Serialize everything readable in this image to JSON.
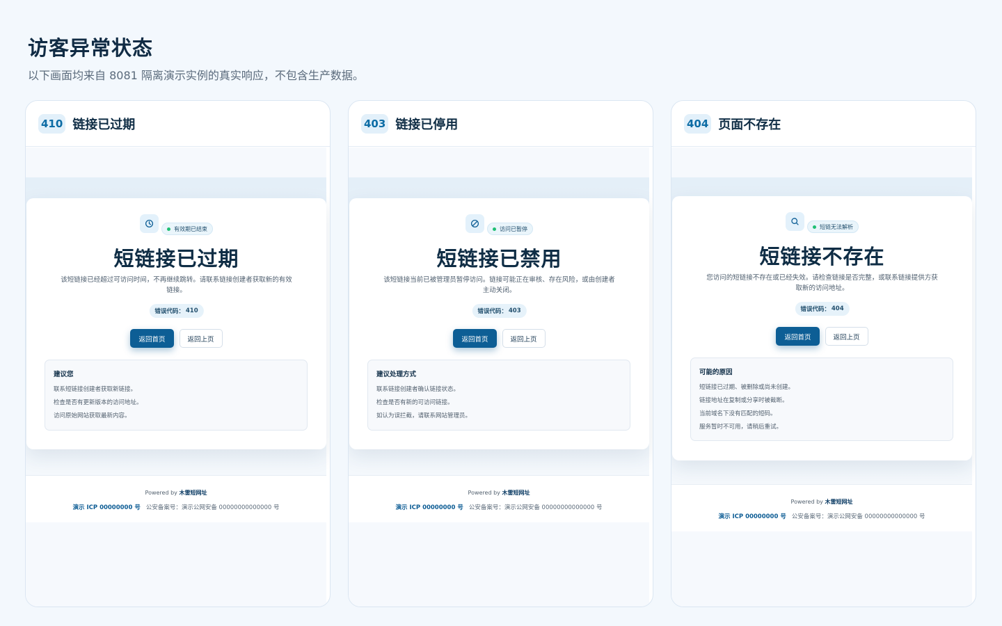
{
  "page": {
    "title": "访客异常状态",
    "subtitle": "以下画面均来自 8081 隔离演示实例的真实响应，不包含生产数据。"
  },
  "cards": [
    {
      "code": "410",
      "title": "链接已过期",
      "icon": "clock-icon",
      "status": "有效期已结束",
      "heading": "短链接已过期",
      "description": "该短链接已经超过可访问时间，不再继续跳转。请联系链接创建者获取新的有效链接。",
      "error_label": "错误代码：",
      "error_code": "410",
      "primary_button": "返回首页",
      "secondary_button": "返回上页",
      "suggest_title": "建议您",
      "suggestions": [
        "联系短链接创建者获取新链接。",
        "检查是否有更新版本的访问地址。",
        "访问原始网站获取最新内容。"
      ]
    },
    {
      "code": "403",
      "title": "链接已停用",
      "icon": "ban-icon",
      "status": "访问已暂停",
      "heading": "短链接已禁用",
      "description": "该短链接当前已被管理员暂停访问。链接可能正在审核、存在风险，或由创建者主动关闭。",
      "error_label": "错误代码：",
      "error_code": "403",
      "primary_button": "返回首页",
      "secondary_button": "返回上页",
      "suggest_title": "建议处理方式",
      "suggestions": [
        "联系链接创建者确认链接状态。",
        "检查是否有新的可访问链接。",
        "如认为误拦截，请联系网站管理员。"
      ]
    },
    {
      "code": "404",
      "title": "页面不存在",
      "icon": "search-icon",
      "status": "短链无法解析",
      "heading": "短链接不存在",
      "description": "您访问的短链接不存在或已经失效。请检查链接是否完整，或联系链接提供方获取新的访问地址。",
      "error_label": "错误代码：",
      "error_code": "404",
      "primary_button": "返回首页",
      "secondary_button": "返回上页",
      "suggest_title": "可能的原因",
      "suggestions": [
        "短链接已过期、被删除或尚未创建。",
        "链接地址在复制或分享时被截断。",
        "当前域名下没有匹配的短码。",
        "服务暂时不可用，请稍后重试。"
      ]
    }
  ],
  "footer": {
    "powered_prefix": "Powered by ",
    "brand": "木雷短网址",
    "icp": "演示 ICP 00000000 号",
    "police": "公安备案号：演示公网安备 00000000000000 号"
  },
  "colors": {
    "background": "#f3f8fd",
    "primary": "#0d5e95",
    "status_dot": "#1fbf74",
    "code_chip": "#0c6ca5"
  }
}
